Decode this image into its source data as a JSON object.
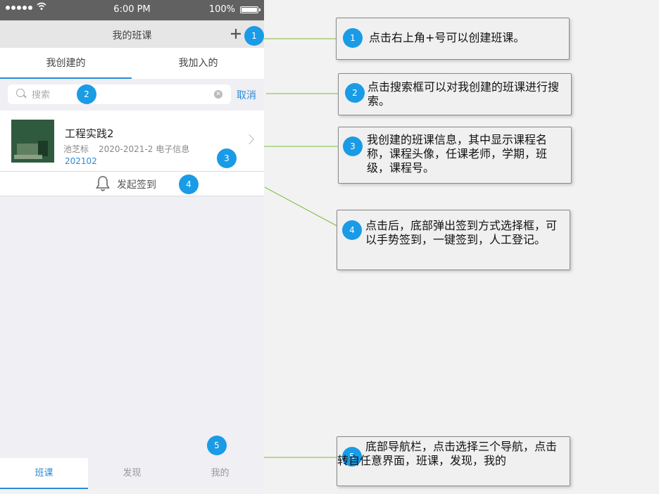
{
  "status_bar": {
    "time": "6:00 PM",
    "battery": "100%"
  },
  "nav": {
    "title": "我的班课"
  },
  "tabs": [
    {
      "label": "我创建的"
    },
    {
      "label": "我加入的"
    }
  ],
  "search": {
    "placeholder": "搜索",
    "cancel": "取消"
  },
  "course": {
    "name": "工程实践2",
    "teacher": "池芝标",
    "term_class": "2020-2021-2 电子信息",
    "code": "202102"
  },
  "checkin": {
    "label": "发起签到"
  },
  "bottom_nav": [
    {
      "label": "班课"
    },
    {
      "label": "发现"
    },
    {
      "label": "我的"
    }
  ],
  "markers": [
    "1",
    "2",
    "3",
    "4",
    "5"
  ],
  "notes": [
    {
      "num": "1",
      "text": "点击右上角+号可以创建班课。"
    },
    {
      "num": "2",
      "text": "点击搜索框可以对我创建的班课进行搜索。"
    },
    {
      "num": "3",
      "text": "我创建的班课信息，其中显示课程名称，课程头像，任课老师，学期，班级，课程号。"
    },
    {
      "num": "4",
      "text": "点击后，底部弹出签到方式选择框，可以手势签到，一键签到，人工登记。"
    },
    {
      "num": "5",
      "text": "底部导航栏，点击选择三个导航，点击转自任意界面，班课，发现，我的"
    }
  ],
  "colors": {
    "accent": "#2b8bd6",
    "marker": "#1a9be6",
    "leader_line": "#7dbb3c"
  }
}
